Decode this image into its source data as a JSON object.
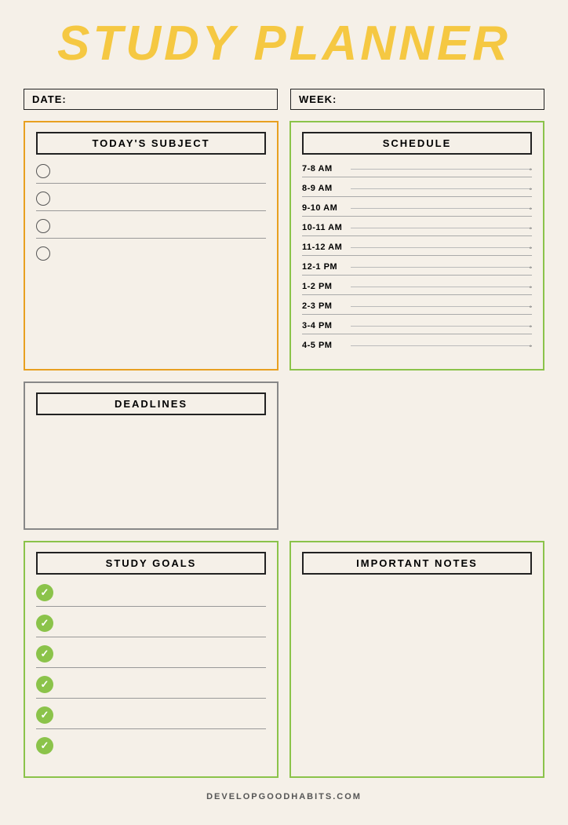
{
  "title": "STUDY PLANNER",
  "date_label": "DATE:",
  "week_label": "WEEK:",
  "sections": {
    "today_subject": {
      "header": "TODAY'S SUBJECT",
      "items": [
        "",
        "",
        "",
        ""
      ]
    },
    "schedule": {
      "header": "SCHEDULE",
      "slots": [
        "7-8 AM",
        "8-9 AM",
        "9-10 AM",
        "10-11 AM",
        "11-12 AM",
        "12-1 PM",
        "1-2 PM",
        "2-3 PM",
        "3-4 PM",
        "4-5 PM"
      ]
    },
    "deadlines": {
      "header": "DEADLINES"
    },
    "study_goals": {
      "header": "STUDY GOALS",
      "items": [
        "",
        "",
        "",
        "",
        "",
        ""
      ]
    },
    "important_notes": {
      "header": "IMPORTANT NOTES"
    }
  },
  "footer": "DEVELOPGOODHABITS.COM"
}
